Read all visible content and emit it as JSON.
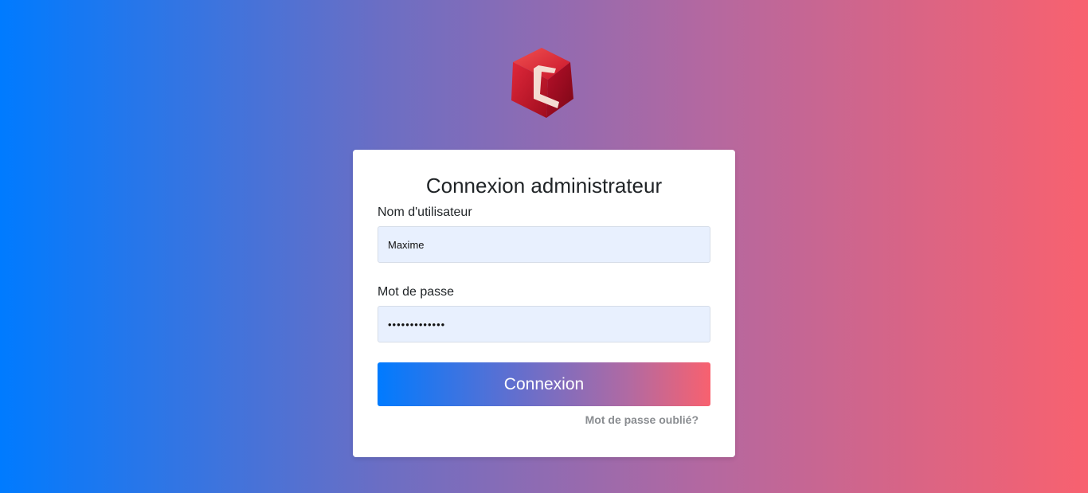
{
  "login": {
    "title": "Connexion administrateur",
    "username_label": "Nom d'utilisateur",
    "username_value": "Maxime",
    "password_label": "Mot de passe",
    "password_value": "•••••••••••••",
    "submit_label": "Connexion",
    "forgot_label": "Mot de passe oublié?"
  },
  "logo": {
    "icon": "cube-c-logo-icon"
  },
  "colors": {
    "gradient_start": "#007bff",
    "gradient_end": "#f8616f",
    "input_background": "#e8f0fe",
    "card_background": "#ffffff"
  }
}
